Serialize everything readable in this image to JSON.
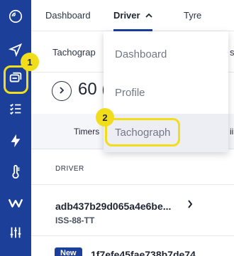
{
  "topnav": {
    "tabs": [
      {
        "label": "Dashboard"
      },
      {
        "label": "Driver"
      },
      {
        "label": "Tyre"
      }
    ]
  },
  "page": {
    "subheader_title": "Tachograp",
    "subheader_right": "s",
    "count": "60 (",
    "tab_timers": "Timers",
    "tab_right": "ii",
    "column_driver": "DRIVER"
  },
  "rows": {
    "driver": {
      "id": "adb437b29d065a4e6be...",
      "plate": "ISS-88-TT"
    },
    "new": {
      "badge": "New",
      "id": "1f7efe45fae738b7de74"
    }
  },
  "dropdown": {
    "items": [
      {
        "label": "Dashboard"
      },
      {
        "label": "Profile"
      },
      {
        "label": "Tachograph"
      }
    ]
  },
  "annotations": {
    "step1": "1",
    "step2": "2"
  },
  "colors": {
    "sidebar": "#1c3f9a",
    "highlight": "#f2dd1d"
  }
}
